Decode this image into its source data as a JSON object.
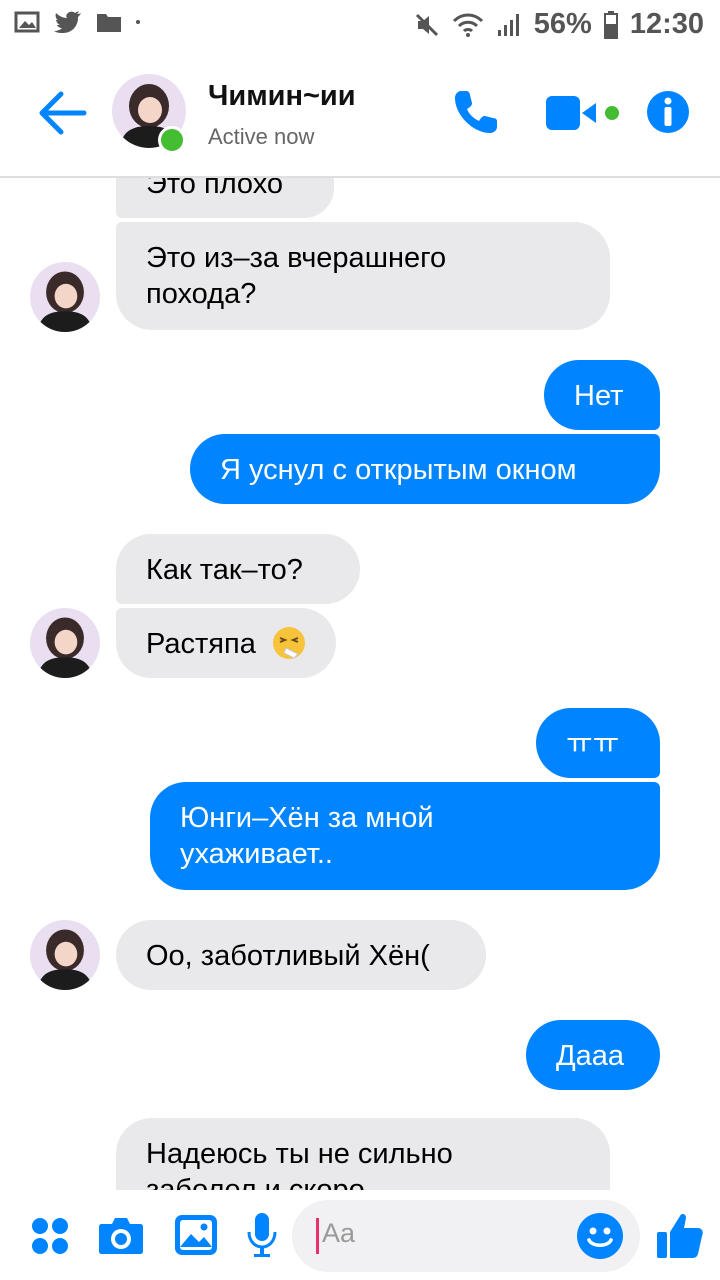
{
  "status_bar": {
    "battery": "56%",
    "time": "12:30"
  },
  "header": {
    "name": "Чимин~ии",
    "status": "Active now"
  },
  "messages": {
    "m1": "Это плохо",
    "m2_l1": "Это из–за вчерашнего",
    "m2_l2": "похода?",
    "m3": "Нет",
    "m4": "Я уснул с открытым окном",
    "m5": "Как так–то?",
    "m6": "Растяпа",
    "m7": "ㅠㅠ",
    "m8_l1": "Юнги–Хён за мной",
    "m8_l2": "ухаживает..",
    "m9": "Оо, заботливый Хён(",
    "m10": "Дааа",
    "m11_l1": "Надеюсь ты не сильно",
    "m11_l2": "заболел и скоро"
  },
  "composer": {
    "placeholder": "Aa"
  },
  "colors": {
    "accent": "#0084ff",
    "incoming": "#e9e9eb",
    "online": "#44bd32"
  },
  "icons": [
    "back-arrow-icon",
    "phone-icon",
    "video-camera-icon",
    "info-icon",
    "apps-icon",
    "camera-icon",
    "gallery-icon",
    "microphone-icon",
    "emoji-icon",
    "like-thumb-icon"
  ]
}
